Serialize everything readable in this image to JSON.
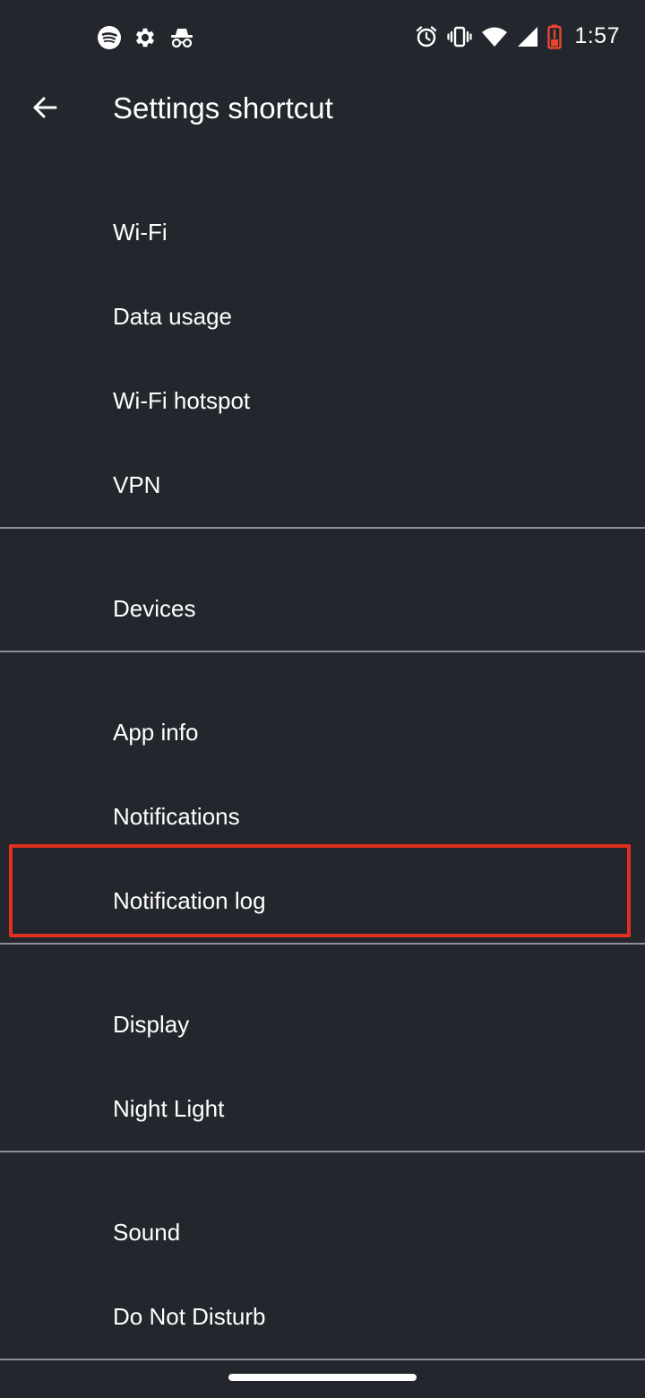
{
  "status_bar": {
    "time": "1:57",
    "left_icons": [
      "spotify-icon",
      "gear-icon",
      "incognito-icon"
    ],
    "right_icons": [
      "alarm-icon",
      "vibrate-icon",
      "wifi-icon",
      "signal-icon",
      "battery-icon"
    ],
    "battery_color": "#e8472e"
  },
  "app_bar": {
    "title": "Settings shortcut"
  },
  "groups": [
    {
      "items": [
        "Wi-Fi",
        "Data usage",
        "Wi-Fi hotspot",
        "VPN"
      ]
    },
    {
      "items": [
        "Devices"
      ]
    },
    {
      "items": [
        "App info",
        "Notifications",
        "Notification log"
      ]
    },
    {
      "items": [
        "Display",
        "Night Light"
      ]
    },
    {
      "items": [
        "Sound",
        "Do Not Disturb"
      ]
    }
  ],
  "highlighted_item": "Notification log",
  "colors": {
    "background": "#23272d",
    "divider": "#8c9096",
    "highlight": "#e0301e"
  }
}
